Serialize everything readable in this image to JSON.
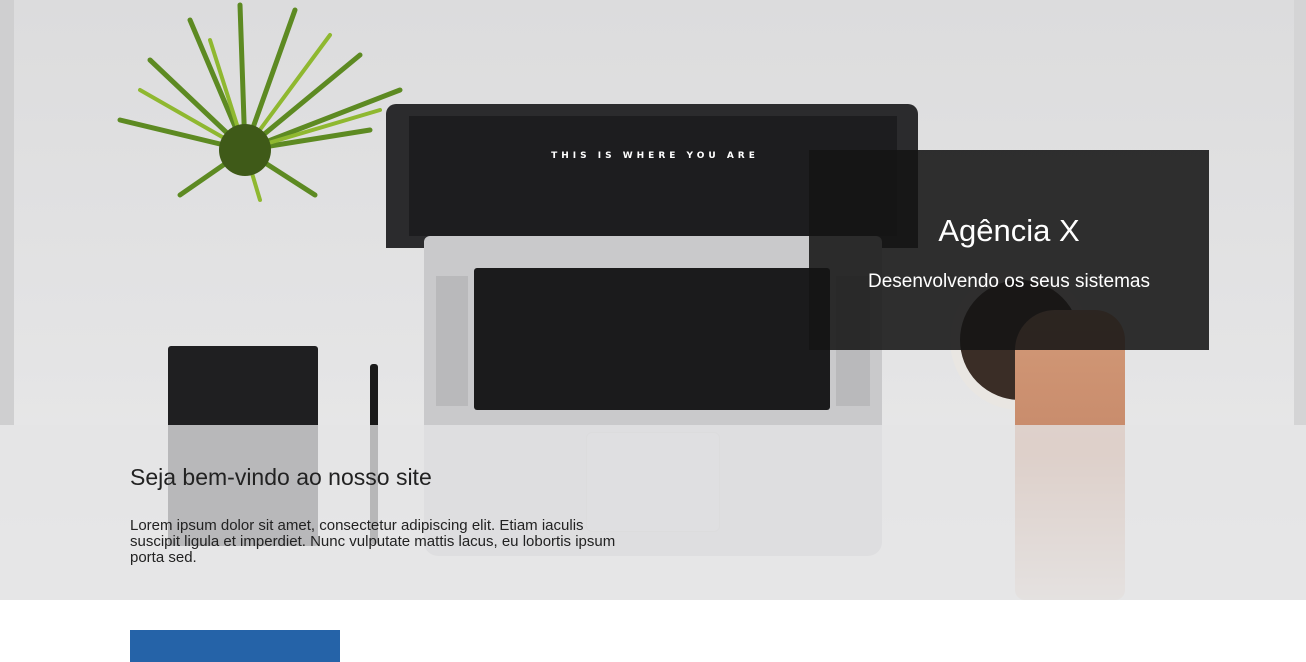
{
  "hero": {
    "screen_text": "THIS IS WHERE YOU ARE",
    "banner": {
      "title": "Agência X",
      "subtitle": "Desenvolvendo os seus sistemas"
    }
  },
  "welcome": {
    "title": "Seja bem-vindo ao nosso site",
    "text": "Lorem ipsum dolor sit amet, consectetur adipiscing elit. Etiam iaculis suscipit ligula et imperdiet. Nunc vulputate mattis lacus, eu lobortis ipsum porta sed."
  },
  "colors": {
    "banner_bg": "#141414",
    "button_blue": "#2563a8"
  }
}
